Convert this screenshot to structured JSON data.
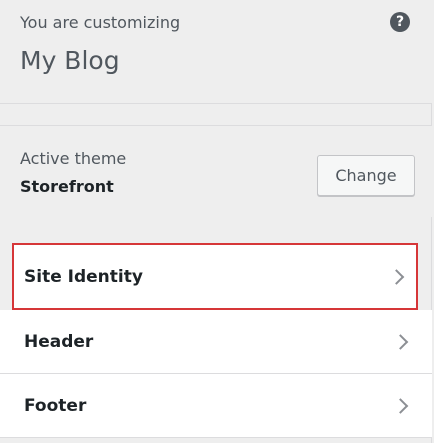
{
  "info": {
    "notice": "You are customizing",
    "site_title": "My Blog",
    "help_label": "?"
  },
  "theme": {
    "label": "Active theme",
    "name": "Storefront",
    "change_label": "Change"
  },
  "menu": {
    "items": [
      {
        "label": "Site Identity",
        "icon": "chevron-right-icon"
      },
      {
        "label": "Header",
        "icon": "chevron-right-icon"
      },
      {
        "label": "Footer",
        "icon": "chevron-right-icon"
      }
    ]
  },
  "colors": {
    "highlight": "#d63638",
    "panel_bg": "#eeeeee",
    "item_bg": "#ffffff"
  }
}
